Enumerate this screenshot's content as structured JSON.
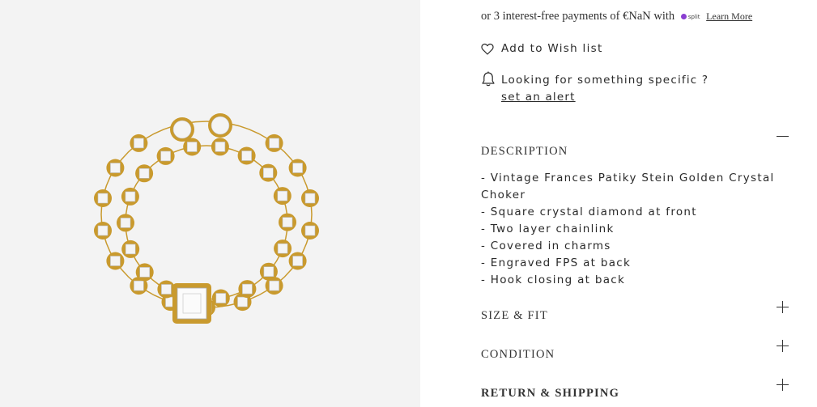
{
  "product_image": {
    "alt": "",
    "background": "#f3f3f3",
    "metal_color": "#c99a2e",
    "stone_color": "#f4f4f4"
  },
  "payment": {
    "text": "or 3 interest-free payments of €NaN with",
    "provider_logo_text": "split",
    "provider_color": "#8a3fd1",
    "learn_more": "Learn More"
  },
  "wishlist": {
    "icon": "heart-icon",
    "label": "Add to Wish list"
  },
  "alert": {
    "icon": "bell-icon",
    "prompt": "Looking for something specific ?",
    "link": "set an alert"
  },
  "sections": {
    "description": {
      "title": "DESCRIPTION",
      "expanded": true,
      "items": [
        "- Vintage Frances Patiky Stein Golden Crystal Choker",
        "- Square crystal diamond at front",
        "- Two layer chainlink",
        "- Covered in charms",
        "- Engraved FPS at back",
        "- Hook closing at back"
      ]
    },
    "size_fit": {
      "title": "SIZE & FIT",
      "expanded": false
    },
    "condition": {
      "title": "CONDITION",
      "expanded": false
    },
    "return_shipping": {
      "title": "RETURN & SHIPPING",
      "expanded": false
    }
  }
}
